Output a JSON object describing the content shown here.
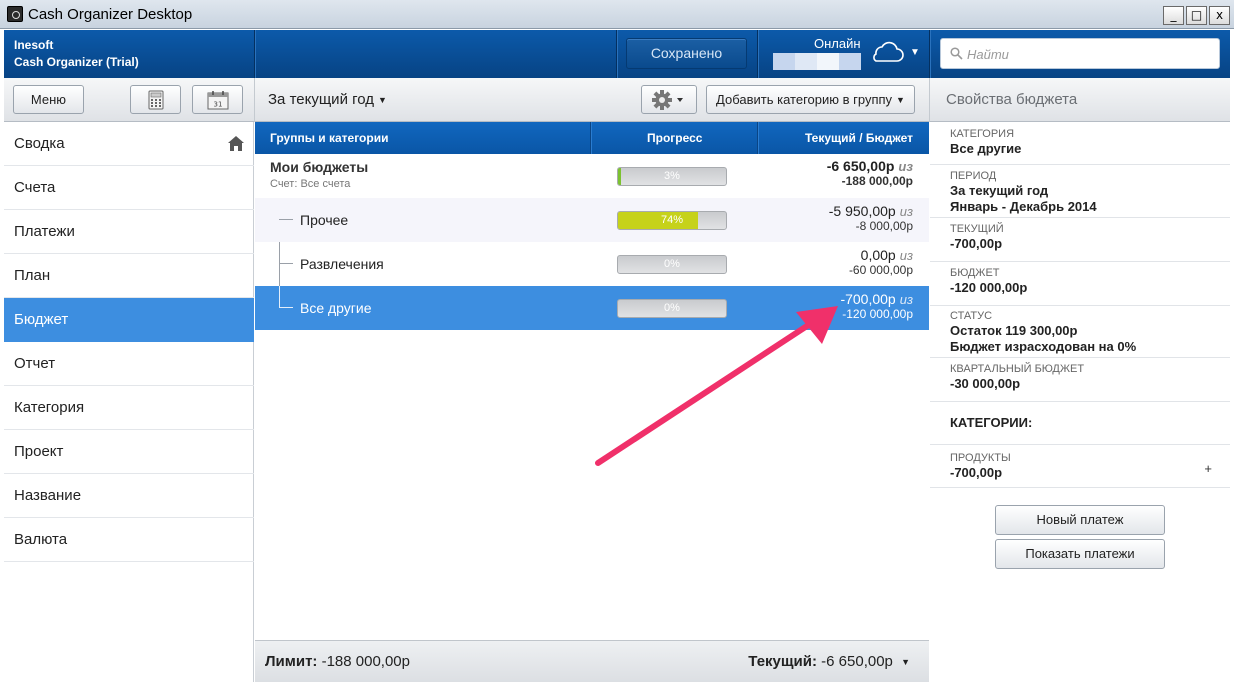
{
  "window": {
    "title": "Cash Organizer Desktop",
    "minimize": "_",
    "maximize": "□",
    "close": "x"
  },
  "header": {
    "company": "Inesoft",
    "product": "Cash Organizer (Trial)",
    "saved_label": "Сохранено",
    "online_label": "Онлайн",
    "search_placeholder": "Найти"
  },
  "toolbar": {
    "menu_label": "Меню",
    "period_label": "За текущий год",
    "add_category_label": "Добавить категорию в группу",
    "properties_title": "Свойства бюджета"
  },
  "sidebar": {
    "items": [
      {
        "label": "Сводка"
      },
      {
        "label": "Счета"
      },
      {
        "label": "Платежи"
      },
      {
        "label": "План"
      },
      {
        "label": "Бюджет",
        "active": true
      },
      {
        "label": "Отчет"
      },
      {
        "label": "Категория"
      },
      {
        "label": "Проект"
      },
      {
        "label": "Название"
      },
      {
        "label": "Валюта"
      }
    ]
  },
  "grid": {
    "columns": [
      "Группы и категории",
      "Прогресс",
      "Текущий / Бюджет"
    ],
    "of_word": "из",
    "rows": [
      {
        "name": "Мои бюджеты",
        "subtitle": "Счет: Все счета",
        "progress": 3,
        "progress_label": "3%",
        "current": "-6 650,00р",
        "budget": "-188 000,00р"
      },
      {
        "name": "Прочее",
        "progress": 74,
        "progress_label": "74%",
        "current": "-5 950,00р",
        "budget": "-8 000,00р"
      },
      {
        "name": "Развлечения",
        "progress": 0,
        "progress_label": "0%",
        "current": "0,00р",
        "budget": "-60 000,00р"
      },
      {
        "name": "Все другие",
        "progress": 0,
        "progress_label": "0%",
        "current": "-700,00р",
        "budget": "-120 000,00р",
        "selected": true
      }
    ],
    "footer": {
      "limit_label": "Лимит:",
      "limit_value": "-188 000,00р",
      "current_label": "Текущий:",
      "current_value": "-6 650,00р"
    }
  },
  "properties": {
    "category_label": "КАТЕГОРИЯ",
    "category_value": "Все другие",
    "period_label": "ПЕРИОД",
    "period_value_1": "За текущий год",
    "period_value_2": "Январь - Декабрь 2014",
    "current_label": "ТЕКУЩИЙ",
    "current_value": "-700,00р",
    "budget_label": "БЮДЖЕТ",
    "budget_value": "-120 000,00р",
    "status_label": "СТАТУС",
    "status_value_1": "Остаток 119 300,00р",
    "status_value_2": "Бюджет израсходован на 0%",
    "quarterly_label": "КВАРТАЛЬНЫЙ БЮДЖЕТ",
    "quarterly_value": "-30 000,00р",
    "categories_title": "КАТЕГОРИИ:",
    "product_label": "ПРОДУКТЫ",
    "product_value": "-700,00р",
    "plus": "+",
    "new_payment_label": "Новый платеж",
    "show_payments_label": "Показать платежи"
  },
  "colors": {
    "header_blue": "#0a4f9a",
    "selection_blue": "#3d8ee0",
    "progress_green": "#7cc230",
    "progress_yellow": "#c6d21a",
    "annotation_arrow": "#f0306a"
  }
}
